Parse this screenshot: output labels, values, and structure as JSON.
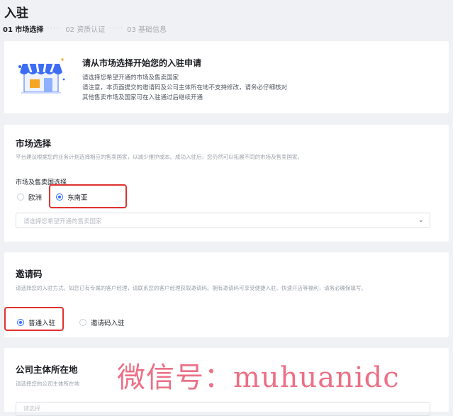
{
  "page": {
    "title": "入驻"
  },
  "steps": [
    {
      "label": "01 市场选择",
      "active": true
    },
    {
      "label": "02 资质认证",
      "active": false
    },
    {
      "label": "03 基础信息",
      "active": false
    }
  ],
  "step_separator": "·····",
  "intro": {
    "title": "请从市场选择开始您的入驻申请",
    "lines": [
      "请选择您希望开通的市场及售卖国家",
      "请注意，本页面提交的邀请码及公司主体所在地不支持修改，请务必仔细核对",
      "其他售卖市场及国家可在入驻通过后继续开通"
    ]
  },
  "market": {
    "title": "市场选择",
    "desc": "平台建议根据您的业务计划选择相应的售卖国家，以减少维护成本。成功入驻后，您仍然可以拓展不同的市场及售卖国家。",
    "field_label": "市场及售卖国选择",
    "options": [
      {
        "label": "欧洲",
        "checked": false
      },
      {
        "label": "东南亚",
        "checked": true
      }
    ],
    "country_placeholder": "请选择您希望开通的售卖国家"
  },
  "invite": {
    "title": "邀请码",
    "desc": "请选择您的入驻方式。如您已有专属的客户经理，请联系您的客户经理获取邀请码。拥有邀请码可享受便捷入驻、快速开店等福利，请务必确保填写。",
    "options": [
      {
        "label": "普通入驻",
        "checked": true
      },
      {
        "label": "邀请码入驻",
        "checked": false
      }
    ]
  },
  "company": {
    "title": "公司主体所在地",
    "desc": "请选择您的公司主体所在地",
    "placeholder": "请选择"
  },
  "watermark": "微信号：muhuanidc",
  "colors": {
    "accent": "#2f6bff",
    "highlight": "#e0322f",
    "watermark": "#e8627a"
  }
}
